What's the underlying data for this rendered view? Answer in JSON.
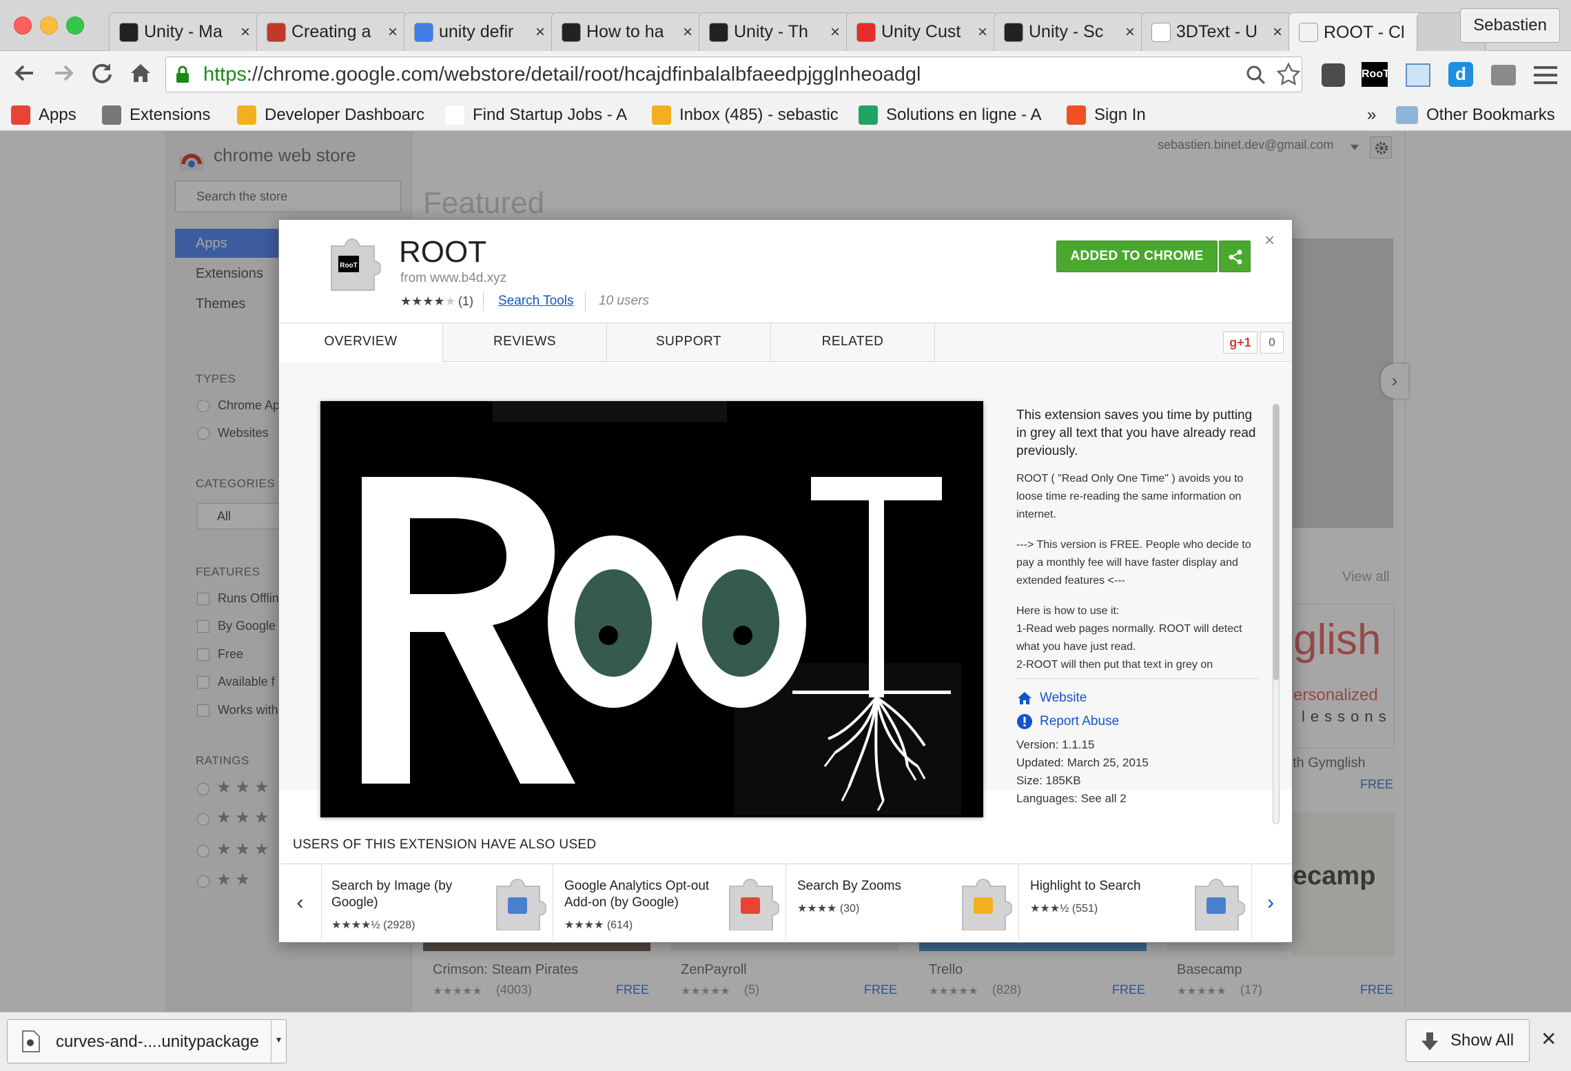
{
  "profile": "Sebastien",
  "tabs": [
    {
      "label": "Unity - Ma",
      "icon": "unity-icon",
      "color": "#222222"
    },
    {
      "label": "Creating a",
      "icon": "cubes-icon",
      "color": "#c0392b"
    },
    {
      "label": "unity defir",
      "icon": "google-icon",
      "color": "#3f7ee8"
    },
    {
      "label": "How to ha",
      "icon": "unity-icon",
      "color": "#222222"
    },
    {
      "label": "Unity - Th",
      "icon": "unity-icon",
      "color": "#222222"
    },
    {
      "label": "Unity Cust",
      "icon": "youtube-icon",
      "color": "#e52d27"
    },
    {
      "label": "Unity - Sc",
      "icon": "unity-icon",
      "color": "#222222"
    },
    {
      "label": "3DText - U",
      "icon": "page-icon",
      "color": "#ffffff"
    },
    {
      "label": "ROOT - Cl",
      "icon": "webstore-icon",
      "color": "#f2f2f2"
    }
  ],
  "omnibox": {
    "scheme": "https",
    "rest": "://chrome.google.com/webstore/detail/root/hcajdfinbalalbfaeedpjgglnheoadgl"
  },
  "bookmarks": [
    {
      "label": "Apps",
      "icon": "apps-grid-icon"
    },
    {
      "label": "Extensions",
      "icon": "puzzle-icon"
    },
    {
      "label": "Developer Dashboarc",
      "icon": "webstore-icon"
    },
    {
      "label": "Find Startup Jobs - A",
      "icon": "victory-hand-icon"
    },
    {
      "label": "Inbox (485) - sebastic",
      "icon": "webstore-icon"
    },
    {
      "label": "Solutions en ligne - A",
      "icon": "leaf-icon"
    },
    {
      "label": "Sign In",
      "icon": "windows-logo-icon"
    }
  ],
  "bookmarks_overflow": "»",
  "other_bookmarks": "Other Bookmarks",
  "store": {
    "logo_text": "chrome web store",
    "search_placeholder": "Search the store",
    "account": "sebastien.binet.dev@gmail.com",
    "featured": "Featured",
    "nav": [
      "Apps",
      "Extensions",
      "Themes"
    ],
    "types_head": "TYPES",
    "types": [
      "Chrome Ap",
      "Websites"
    ],
    "categories_head": "CATEGORIES",
    "category_value": "All",
    "features_head": "FEATURES",
    "features": [
      "Runs Offlin",
      "By Google",
      "Free",
      "Available f",
      "Works with"
    ],
    "ratings_head": "RATINGS",
    "view_all": "View all",
    "bg_right_items": [
      {
        "name": "glish",
        "sub": "ersonalized",
        "sub2": "lessons",
        "footer": "th Gymglish",
        "price": "FREE"
      },
      {
        "name": "ecamp"
      }
    ],
    "bg_bottom": [
      {
        "name": "Crimson: Steam Pirates",
        "count": "(4003)",
        "price": "FREE"
      },
      {
        "name": "ZenPayroll",
        "count": "(5)",
        "price": "FREE"
      },
      {
        "name": "Trello",
        "count": "(828)",
        "price": "FREE"
      },
      {
        "name": "Basecamp",
        "count": "(17)",
        "price": "FREE"
      }
    ]
  },
  "dialog": {
    "title": "ROOT",
    "from": "from www.b4d.xyz",
    "rating_count": "(1)",
    "category": "Search Tools",
    "users": "10 users",
    "added_label": "ADDED TO CHROME",
    "close": "×",
    "tabs": [
      "OVERVIEW",
      "REVIEWS",
      "SUPPORT",
      "RELATED"
    ],
    "gplus": "g+1",
    "gplus_count": "0",
    "description": {
      "lead": "This extension saves you time by putting in grey all text that you have already read previously.",
      "p1": "ROOT ( \"Read Only One Time\" ) avoids you to loose time re-reading the same information on internet.",
      "p2": "---> This version is FREE. People who decide to pay a monthly fee will have faster display  and extended features <---",
      "p3a": "Here is how to use it:",
      "p3b": "1-Read web pages normally. ROOT will detect what you have just read.",
      "p3c": "2-ROOT will then put that text in grey on"
    },
    "website": "Website",
    "report": "Report Abuse",
    "version": "Version: 1.1.15",
    "updated": "Updated: March 25, 2015",
    "size": "Size: 185KB",
    "languages": "Languages: See all 2",
    "also_title": "USERS OF THIS EXTENSION HAVE ALSO USED",
    "also": [
      {
        "name": "Search by Image (by Google)",
        "count": "(2928)",
        "icon": "camera-icon"
      },
      {
        "name": "Google Analytics Opt-out Add-on (by Google)",
        "count": "(614)",
        "icon": "google-g-icon"
      },
      {
        "name": "Search By Zooms",
        "count": "(30)",
        "icon": "magnifier-zoom-icon"
      },
      {
        "name": "Highlight to Search",
        "count": "(551)",
        "icon": "search-page-icon"
      }
    ]
  },
  "download": {
    "filename": "curves-and-....unitypackage",
    "show_all": "Show All"
  },
  "colors": {
    "accent_green": "#4aa82f",
    "link_blue": "#1155cc",
    "https_green": "#1a8a1a"
  }
}
